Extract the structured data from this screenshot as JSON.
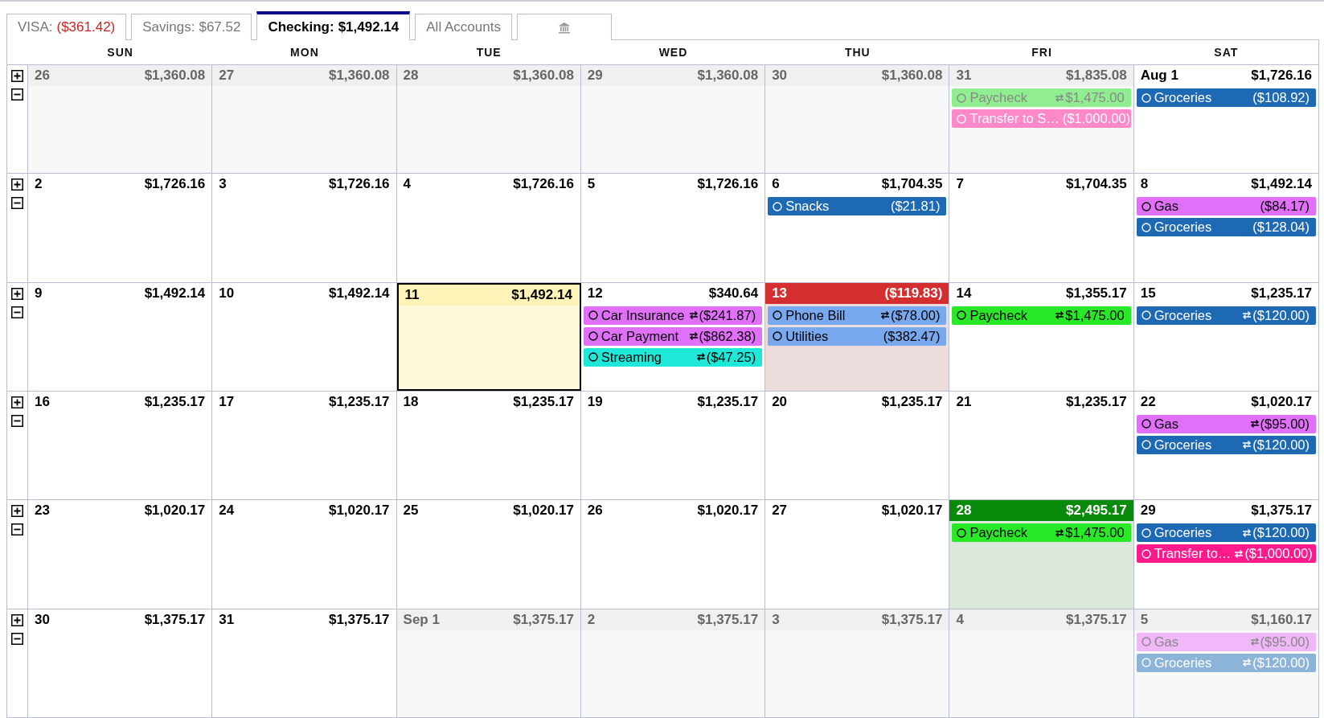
{
  "tabs": [
    {
      "label": "VISA:",
      "value": "($361.42)",
      "negative": true,
      "selected": false,
      "kind": "text"
    },
    {
      "label": "Savings:",
      "value": "$67.52",
      "negative": false,
      "selected": false,
      "kind": "text"
    },
    {
      "label": "Checking:",
      "value": "$1,492.14",
      "negative": false,
      "selected": true,
      "kind": "text"
    },
    {
      "label": "All Accounts",
      "selected": false,
      "kind": "text"
    },
    {
      "selected": false,
      "kind": "icon"
    }
  ],
  "weekdays": [
    "SUN",
    "MON",
    "TUE",
    "WED",
    "THU",
    "FRI",
    "SAT"
  ],
  "weeks": [
    {
      "days": [
        {
          "label": "26",
          "balance": "$1,360.08",
          "kind": "outside"
        },
        {
          "label": "27",
          "balance": "$1,360.08",
          "kind": "outside"
        },
        {
          "label": "28",
          "balance": "$1,360.08",
          "kind": "outside"
        },
        {
          "label": "29",
          "balance": "$1,360.08",
          "kind": "outside"
        },
        {
          "label": "30",
          "balance": "$1,360.08",
          "kind": "outside"
        },
        {
          "label": "31",
          "balance": "$1,835.08",
          "kind": "outside",
          "events": [
            {
              "name": "Paycheck",
              "amount": "$1,475.00",
              "recurring": true,
              "color": "#90ee90",
              "light_text": false
            },
            {
              "name": "Transfer to S…",
              "amount": "($1,000.00)",
              "recurring": false,
              "color": "#ff88c8",
              "light_text": true
            }
          ]
        },
        {
          "label": "Aug 1",
          "balance": "$1,726.16",
          "kind": "normal",
          "events": [
            {
              "name": "Groceries",
              "amount": "($108.92)",
              "recurring": false,
              "color": "#1e69b4",
              "light_text": true
            }
          ]
        }
      ]
    },
    {
      "days": [
        {
          "label": "2",
          "balance": "$1,726.16",
          "kind": "normal"
        },
        {
          "label": "3",
          "balance": "$1,726.16",
          "kind": "normal"
        },
        {
          "label": "4",
          "balance": "$1,726.16",
          "kind": "normal"
        },
        {
          "label": "5",
          "balance": "$1,726.16",
          "kind": "normal"
        },
        {
          "label": "6",
          "balance": "$1,704.35",
          "kind": "normal",
          "events": [
            {
              "name": "Snacks",
              "amount": "($21.81)",
              "recurring": false,
              "color": "#1e69b4",
              "light_text": true
            }
          ]
        },
        {
          "label": "7",
          "balance": "$1,704.35",
          "kind": "normal"
        },
        {
          "label": "8",
          "balance": "$1,492.14",
          "kind": "normal",
          "events": [
            {
              "name": "Gas",
              "amount": "($84.17)",
              "recurring": false,
              "color": "#e070f8",
              "light_text": false
            },
            {
              "name": "Groceries",
              "amount": "($128.04)",
              "recurring": false,
              "color": "#1e69b4",
              "light_text": true
            }
          ]
        }
      ]
    },
    {
      "days": [
        {
          "label": "9",
          "balance": "$1,492.14",
          "kind": "normal"
        },
        {
          "label": "10",
          "balance": "$1,492.14",
          "kind": "normal"
        },
        {
          "label": "11",
          "balance": "$1,492.14",
          "kind": "today"
        },
        {
          "label": "12",
          "balance": "$340.64",
          "kind": "normal",
          "events": [
            {
              "name": "Car Insurance",
              "amount": "($241.87)",
              "recurring": true,
              "color": "#e070f8",
              "light_text": false
            },
            {
              "name": "Car Payment",
              "amount": "($862.38)",
              "recurring": true,
              "color": "#e070f8",
              "light_text": false
            },
            {
              "name": "Streaming",
              "amount": "($47.25)",
              "recurring": true,
              "color": "#1ee8d8",
              "light_text": false
            }
          ]
        },
        {
          "label": "13",
          "balance": "($119.83)",
          "kind": "low",
          "events": [
            {
              "name": "Phone Bill",
              "amount": "($78.00)",
              "recurring": true,
              "color": "#78a8ee",
              "light_text": false
            },
            {
              "name": "Utilities",
              "amount": "($382.47)",
              "recurring": false,
              "color": "#78a8ee",
              "light_text": false
            }
          ]
        },
        {
          "label": "14",
          "balance": "$1,355.17",
          "kind": "normal",
          "events": [
            {
              "name": "Paycheck",
              "amount": "$1,475.00",
              "recurring": true,
              "color": "#28e828",
              "light_text": false
            }
          ]
        },
        {
          "label": "15",
          "balance": "$1,235.17",
          "kind": "normal",
          "events": [
            {
              "name": "Groceries",
              "amount": "($120.00)",
              "recurring": true,
              "color": "#1e69b4",
              "light_text": true
            }
          ]
        }
      ]
    },
    {
      "days": [
        {
          "label": "16",
          "balance": "$1,235.17",
          "kind": "normal"
        },
        {
          "label": "17",
          "balance": "$1,235.17",
          "kind": "normal"
        },
        {
          "label": "18",
          "balance": "$1,235.17",
          "kind": "normal"
        },
        {
          "label": "19",
          "balance": "$1,235.17",
          "kind": "normal"
        },
        {
          "label": "20",
          "balance": "$1,235.17",
          "kind": "normal"
        },
        {
          "label": "21",
          "balance": "$1,235.17",
          "kind": "normal"
        },
        {
          "label": "22",
          "balance": "$1,020.17",
          "kind": "normal",
          "events": [
            {
              "name": "Gas",
              "amount": "($95.00)",
              "recurring": true,
              "color": "#e070f8",
              "light_text": false
            },
            {
              "name": "Groceries",
              "amount": "($120.00)",
              "recurring": true,
              "color": "#1e69b4",
              "light_text": true
            }
          ]
        }
      ]
    },
    {
      "days": [
        {
          "label": "23",
          "balance": "$1,020.17",
          "kind": "normal"
        },
        {
          "label": "24",
          "balance": "$1,020.17",
          "kind": "normal"
        },
        {
          "label": "25",
          "balance": "$1,020.17",
          "kind": "normal"
        },
        {
          "label": "26",
          "balance": "$1,020.17",
          "kind": "normal"
        },
        {
          "label": "27",
          "balance": "$1,020.17",
          "kind": "normal"
        },
        {
          "label": "28",
          "balance": "$2,495.17",
          "kind": "high",
          "events": [
            {
              "name": "Paycheck",
              "amount": "$1,475.00",
              "recurring": true,
              "color": "#28e828",
              "light_text": false
            }
          ]
        },
        {
          "label": "29",
          "balance": "$1,375.17",
          "kind": "normal",
          "events": [
            {
              "name": "Groceries",
              "amount": "($120.00)",
              "recurring": true,
              "color": "#1e69b4",
              "light_text": true
            },
            {
              "name": "Transfer to…",
              "amount": "($1,000.00)",
              "recurring": true,
              "color": "#ff1a8c",
              "light_text": true
            }
          ]
        }
      ]
    },
    {
      "days": [
        {
          "label": "30",
          "balance": "$1,375.17",
          "kind": "normal"
        },
        {
          "label": "31",
          "balance": "$1,375.17",
          "kind": "normal"
        },
        {
          "label": "Sep 1",
          "balance": "$1,375.17",
          "kind": "outside"
        },
        {
          "label": "2",
          "balance": "$1,375.17",
          "kind": "outside"
        },
        {
          "label": "3",
          "balance": "$1,375.17",
          "kind": "outside"
        },
        {
          "label": "4",
          "balance": "$1,375.17",
          "kind": "outside"
        },
        {
          "label": "5",
          "balance": "$1,160.17",
          "kind": "outside",
          "events": [
            {
              "name": "Gas",
              "amount": "($95.00)",
              "recurring": true,
              "color": "#f0b8f8",
              "light_text": false
            },
            {
              "name": "Groceries",
              "amount": "($120.00)",
              "recurring": true,
              "color": "#8cb4d8",
              "light_text": true
            }
          ]
        }
      ]
    }
  ]
}
